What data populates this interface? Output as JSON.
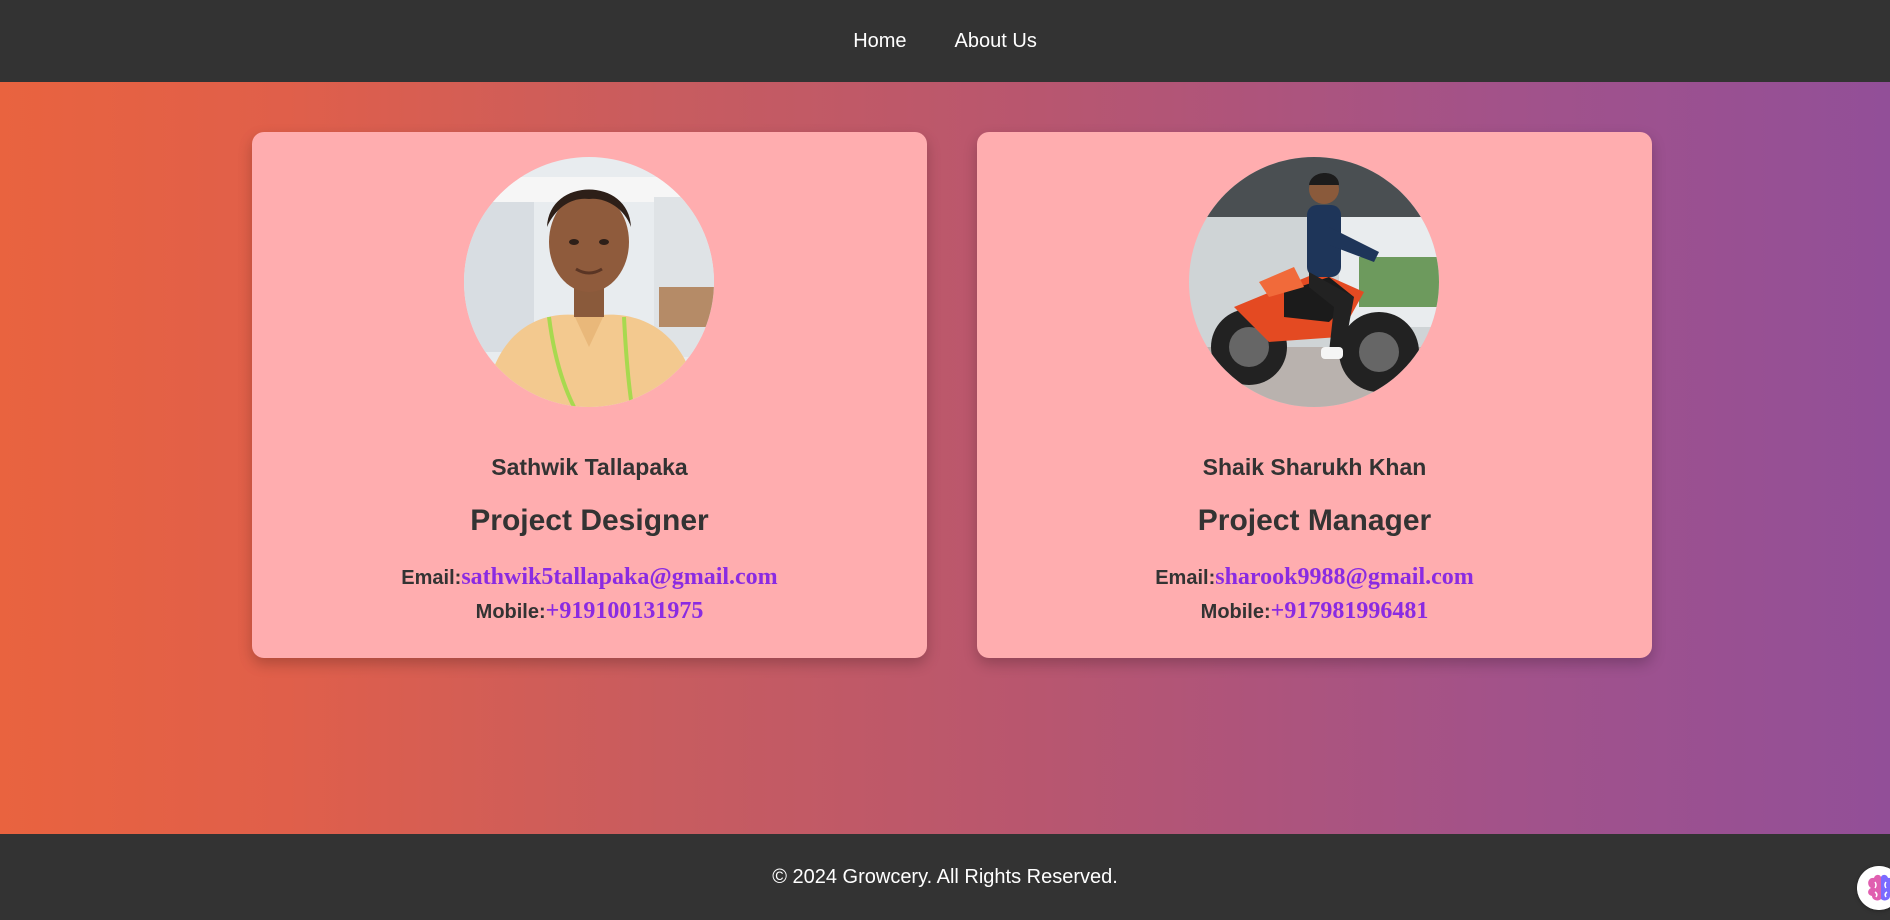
{
  "nav": {
    "items": [
      {
        "label": "Home"
      },
      {
        "label": "About Us"
      }
    ]
  },
  "team": [
    {
      "name": "Sathwik Tallapaka",
      "role": "Project Designer",
      "email_label": "Email:",
      "email": "sathwik5tallapaka@gmail.com",
      "mobile_label": "Mobile:",
      "mobile": "+919100131975"
    },
    {
      "name": "Shaik Sharukh Khan",
      "role": "Project Manager",
      "email_label": "Email:",
      "email": "sharook9988@gmail.com",
      "mobile_label": "Mobile:",
      "mobile": "+917981996481"
    }
  ],
  "footer": {
    "text": "© 2024 Growcery. All Rights Reserved."
  },
  "colors": {
    "nav_bg": "#333333",
    "card_bg": "#ffadaf",
    "link": "#8a2be2",
    "gradient_start": "#e9633f",
    "gradient_end": "#924f98"
  },
  "icons": {
    "floating_widget": "brain-icon"
  }
}
